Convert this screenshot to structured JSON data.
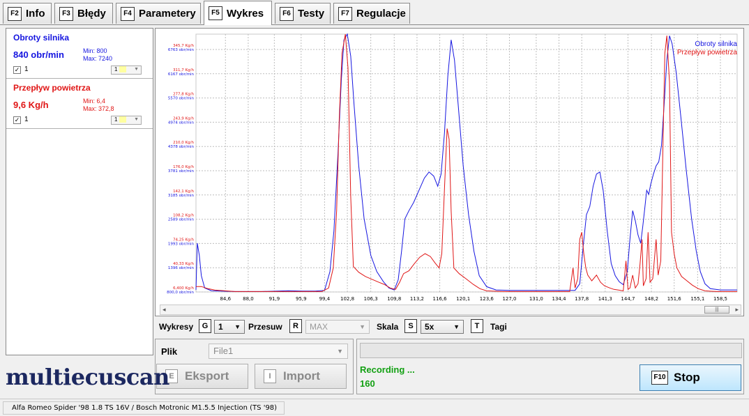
{
  "tabs": [
    {
      "key": "F2",
      "label": "Info"
    },
    {
      "key": "F3",
      "label": "Błędy"
    },
    {
      "key": "F4",
      "label": "Parametery"
    },
    {
      "key": "F5",
      "label": "Wykres"
    },
    {
      "key": "F6",
      "label": "Testy"
    },
    {
      "key": "F7",
      "label": "Regulacje"
    }
  ],
  "active_tab": "Wykres",
  "sensors": [
    {
      "name": "Obroty silnika",
      "value": "840 obr/min",
      "min": "Min: 800",
      "max": "Max: 7240",
      "checkbox_label": "1",
      "combo": "1",
      "color": "#1515e0"
    },
    {
      "name": "Przepływ powietrza",
      "value": "9,6 Kg/h",
      "min": "Min: 6,4",
      "max": "Max: 372,8",
      "checkbox_label": "1",
      "combo": "1",
      "color": "#e01515"
    }
  ],
  "chart_data": {
    "type": "line",
    "x_ticks": [
      "84,6",
      "88,0",
      "91,9",
      "95,9",
      "99,4",
      "102,8",
      "106,3",
      "109,8",
      "113,2",
      "116,6",
      "120,1",
      "123,6",
      "127,0",
      "131,0",
      "134,4",
      "137,8",
      "141,3",
      "144,7",
      "148,2",
      "151,6",
      "155,1",
      "158,5"
    ],
    "x_tick_values": [
      84.6,
      88.0,
      91.9,
      95.9,
      99.4,
      102.8,
      106.3,
      109.8,
      113.2,
      116.6,
      120.1,
      123.6,
      127.0,
      131.0,
      134.4,
      137.8,
      141.3,
      144.7,
      148.2,
      151.6,
      155.1,
      158.5
    ],
    "xlim": [
      80.2,
      161.0
    ],
    "y_ticks_red": [
      "6,400 Kg/h",
      "40,33 Kg/h",
      "74,25 Kg/h",
      "108,2 Kg/h",
      "142,1 Kg/h",
      "176,0 Kg/h",
      "210,0 Kg/h",
      "243,9 Kg/h",
      "277,8 Kg/h",
      "311,7 Kg/h",
      "345,7 Kg/h"
    ],
    "y_ticks_blue": [
      "800,0 obr/min",
      "1396 obr/min",
      "1993 obr/min",
      "2589 obr/min",
      "3185 obr/min",
      "3781 obr/min",
      "4378 obr/min",
      "4974 obr/min",
      "5570 obr/min",
      "6167 obr/min",
      "6763 obr/min"
    ],
    "ylim_red": [
      6.4,
      345.7
    ],
    "ylim_blue": [
      800,
      6763
    ],
    "grid": true,
    "legend_position": "top-right",
    "series": [
      {
        "name": "Obroty silnika",
        "color": "#1515e0",
        "axis": "blue",
        "points": [
          [
            80.2,
            850
          ],
          [
            80.4,
            2000
          ],
          [
            80.7,
            1700
          ],
          [
            81.0,
            1200
          ],
          [
            81.5,
            900
          ],
          [
            82.5,
            830
          ],
          [
            84.0,
            820
          ],
          [
            86,
            810
          ],
          [
            90,
            810
          ],
          [
            94,
            830
          ],
          [
            96,
            820
          ],
          [
            98,
            820
          ],
          [
            99.4,
            840
          ],
          [
            100.2,
            1300
          ],
          [
            100.8,
            2300
          ],
          [
            101.4,
            4200
          ],
          [
            101.9,
            6000
          ],
          [
            102.3,
            7000
          ],
          [
            102.8,
            7240
          ],
          [
            103.3,
            6600
          ],
          [
            103.8,
            5400
          ],
          [
            104.5,
            3900
          ],
          [
            105.3,
            2600
          ],
          [
            106.3,
            1700
          ],
          [
            107.2,
            1300
          ],
          [
            108.2,
            1050
          ],
          [
            109.0,
            900
          ],
          [
            109.8,
            850
          ],
          [
            110.4,
            1100
          ],
          [
            110.9,
            1800
          ],
          [
            111.4,
            2600
          ],
          [
            112.0,
            2800
          ],
          [
            112.7,
            3000
          ],
          [
            113.5,
            3300
          ],
          [
            114.3,
            3600
          ],
          [
            115.0,
            3750
          ],
          [
            115.7,
            3650
          ],
          [
            116.3,
            3400
          ],
          [
            116.8,
            3700
          ],
          [
            117.3,
            4700
          ],
          [
            117.8,
            6100
          ],
          [
            118.3,
            7000
          ],
          [
            118.8,
            6500
          ],
          [
            119.4,
            5300
          ],
          [
            120.1,
            3900
          ],
          [
            120.9,
            2700
          ],
          [
            121.7,
            1800
          ],
          [
            122.5,
            1200
          ],
          [
            123.6,
            930
          ],
          [
            125,
            850
          ],
          [
            127,
            840
          ],
          [
            130,
            840
          ],
          [
            133,
            840
          ],
          [
            135.5,
            840
          ],
          [
            136.8,
            840
          ],
          [
            137.5,
            1000
          ],
          [
            138.0,
            1900
          ],
          [
            138.5,
            2700
          ],
          [
            139.0,
            2900
          ],
          [
            139.5,
            3400
          ],
          [
            140.0,
            3700
          ],
          [
            140.5,
            3750
          ],
          [
            141.0,
            3300
          ],
          [
            141.6,
            2300
          ],
          [
            142.2,
            1500
          ],
          [
            142.8,
            1200
          ],
          [
            143.4,
            1050
          ],
          [
            144.0,
            980
          ],
          [
            144.6,
            1300
          ],
          [
            145.0,
            2100
          ],
          [
            145.4,
            2800
          ],
          [
            145.8,
            2550
          ],
          [
            146.2,
            2200
          ],
          [
            146.6,
            2000
          ],
          [
            146.9,
            2400
          ],
          [
            147.2,
            2850
          ],
          [
            147.5,
            3300
          ],
          [
            147.8,
            3200
          ],
          [
            148.1,
            3450
          ],
          [
            148.5,
            3700
          ],
          [
            148.9,
            3900
          ],
          [
            149.3,
            4000
          ],
          [
            149.7,
            4400
          ],
          [
            150.1,
            5400
          ],
          [
            150.5,
            6500
          ],
          [
            150.9,
            7100
          ],
          [
            151.3,
            6900
          ],
          [
            151.9,
            6200
          ],
          [
            152.6,
            5100
          ],
          [
            153.4,
            3800
          ],
          [
            154.2,
            2600
          ],
          [
            154.9,
            1800
          ],
          [
            155.5,
            1300
          ],
          [
            156.2,
            1000
          ],
          [
            157.0,
            880
          ],
          [
            158.5,
            850
          ],
          [
            161.0,
            850
          ]
        ]
      },
      {
        "name": "Przepływ powietrza",
        "color": "#e01515",
        "axis": "red",
        "points": [
          [
            80.2,
            14
          ],
          [
            81.0,
            14
          ],
          [
            82.0,
            11
          ],
          [
            83.0,
            9
          ],
          [
            84.6,
            8
          ],
          [
            86,
            7
          ],
          [
            90,
            7
          ],
          [
            95,
            7
          ],
          [
            99.0,
            7
          ],
          [
            100.0,
            12
          ],
          [
            100.7,
            40
          ],
          [
            101.2,
            120
          ],
          [
            101.6,
            250
          ],
          [
            102.0,
            340
          ],
          [
            102.5,
            372.8
          ],
          [
            102.9,
            320
          ],
          [
            103.3,
            140
          ],
          [
            103.7,
            42
          ],
          [
            104.5,
            34
          ],
          [
            105.5,
            28
          ],
          [
            106.5,
            24
          ],
          [
            107.5,
            20
          ],
          [
            108.3,
            17
          ],
          [
            109.2,
            12
          ],
          [
            110.0,
            10
          ],
          [
            110.6,
            20
          ],
          [
            111.2,
            32
          ],
          [
            112.0,
            36
          ],
          [
            112.8,
            46
          ],
          [
            113.6,
            55
          ],
          [
            114.4,
            60
          ],
          [
            115.2,
            56
          ],
          [
            115.9,
            47
          ],
          [
            116.5,
            40
          ],
          [
            116.9,
            60
          ],
          [
            117.3,
            150
          ],
          [
            117.7,
            235
          ],
          [
            118.0,
            220
          ],
          [
            118.3,
            120
          ],
          [
            118.7,
            40
          ],
          [
            119.5,
            32
          ],
          [
            120.5,
            25
          ],
          [
            121.6,
            17
          ],
          [
            122.6,
            11
          ],
          [
            123.6,
            8
          ],
          [
            126,
            7
          ],
          [
            130,
            7
          ],
          [
            133,
            7
          ],
          [
            136.0,
            7
          ],
          [
            136.5,
            40
          ],
          [
            136.8,
            12
          ],
          [
            137.2,
            25
          ],
          [
            137.5,
            80
          ],
          [
            137.8,
            90
          ],
          [
            138.1,
            60
          ],
          [
            138.4,
            40
          ],
          [
            138.7,
            30
          ],
          [
            139.3,
            22
          ],
          [
            140.0,
            30
          ],
          [
            140.6,
            20
          ],
          [
            141.2,
            15
          ],
          [
            142.0,
            12
          ],
          [
            142.6,
            10
          ],
          [
            143.3,
            9
          ],
          [
            144.0,
            8
          ],
          [
            144.4,
            50
          ],
          [
            144.7,
            10
          ],
          [
            145.0,
            12
          ],
          [
            145.4,
            30
          ],
          [
            145.8,
            12
          ],
          [
            146.2,
            18
          ],
          [
            146.5,
            45
          ],
          [
            146.8,
            80
          ],
          [
            147.0,
            15
          ],
          [
            147.4,
            25
          ],
          [
            147.7,
            90
          ],
          [
            148.0,
            20
          ],
          [
            148.4,
            25
          ],
          [
            148.9,
            80
          ],
          [
            149.2,
            30
          ],
          [
            149.6,
            50
          ],
          [
            149.9,
            200
          ],
          [
            150.2,
            340
          ],
          [
            150.5,
            365
          ],
          [
            150.9,
            300
          ],
          [
            151.2,
            90
          ],
          [
            151.6,
            60
          ],
          [
            152.0,
            40
          ],
          [
            152.7,
            28
          ],
          [
            153.5,
            22
          ],
          [
            154.3,
            16
          ],
          [
            155.2,
            11
          ],
          [
            156.2,
            8
          ],
          [
            158.0,
            7
          ],
          [
            161.0,
            7
          ]
        ]
      }
    ]
  },
  "legend": [
    "Obroty silnika",
    "Przepływ powietrza"
  ],
  "controls": {
    "wykresy_label": "Wykresy",
    "wykresy_key": "G",
    "wykresy_value": "1",
    "przesuw_label": "Przesuw",
    "przesuw_key": "R",
    "przesuw_value": "MAX",
    "skala_label": "Skala",
    "skala_key": "S",
    "skala_value": "5x",
    "tagi_key": "T",
    "tagi_label": "Tagi"
  },
  "file": {
    "label": "Plik",
    "value": "File1",
    "export_key": "E",
    "export_label": "Eksport",
    "import_key": "I",
    "import_label": "Import"
  },
  "recording": {
    "status": "Recording ...",
    "count": "160",
    "stop_key": "F10",
    "stop_label": "Stop"
  },
  "logo": "multiecuscan",
  "statusbar": {
    "vehicle": "Alfa Romeo Spider '98 1.8 TS 16V / Bosch Motronic M1.5.5 Injection (TS '98)"
  },
  "colors": {
    "blue_series": "#1515e0",
    "red_series": "#e01515",
    "recording_green": "#12a012",
    "logo": "#1c2860"
  }
}
